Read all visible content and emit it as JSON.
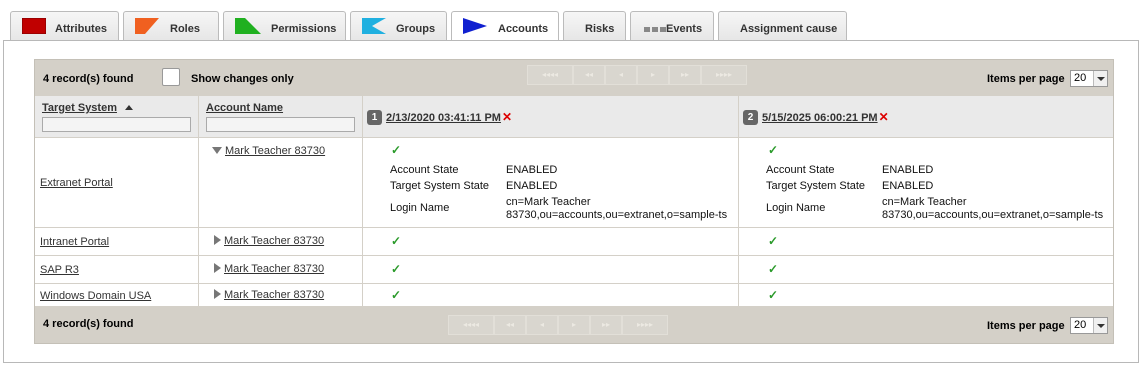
{
  "tabs": [
    {
      "label": "Attributes",
      "icon": "red-flag-icon",
      "color": "#c00000"
    },
    {
      "label": "Roles",
      "icon": "orange-flag-icon",
      "color": "#f06020"
    },
    {
      "label": "Permissions",
      "icon": "green-flag-icon",
      "color": "#20b020"
    },
    {
      "label": "Groups",
      "icon": "cyan-flag-icon",
      "color": "#20b0e0"
    },
    {
      "label": "Accounts",
      "icon": "blue-flag-icon",
      "color": "#1020d0",
      "active": true
    },
    {
      "label": "Risks"
    },
    {
      "label": "Events",
      "icon": "bars-icon"
    },
    {
      "label": "Assignment cause"
    }
  ],
  "toolbar": {
    "records_found": "4 record(s) found",
    "show_changes_label": "Show changes only",
    "items_per_page_label": "Items per page",
    "items_per_page_value": "20"
  },
  "columns": {
    "target_system": "Target System",
    "account_name": "Account Name",
    "snapshot1_number": "1",
    "snapshot1_date": "2/13/2020 03:41:11 PM",
    "snapshot2_number": "2",
    "snapshot2_date": "5/15/2025 06:00:21 PM"
  },
  "rows": [
    {
      "target_system": "Extranet Portal",
      "account": "Mark Teacher 83730",
      "expanded": true,
      "details": {
        "account_state_label": "Account State",
        "account_state": "ENABLED",
        "target_state_label": "Target System State",
        "target_state": "ENABLED",
        "login_label": "Login Name",
        "login_line1": "cn=Mark Teacher",
        "login_line2": "83730,ou=accounts,ou=extranet,o=sample-ts"
      }
    },
    {
      "target_system": "Intranet Portal",
      "account": "Mark Teacher 83730"
    },
    {
      "target_system": "SAP R3",
      "account": "Mark Teacher 83730"
    },
    {
      "target_system": "Windows Domain USA",
      "account": "Mark Teacher 83730"
    }
  ],
  "check_glyph": "✓",
  "remove_glyph": "✕"
}
